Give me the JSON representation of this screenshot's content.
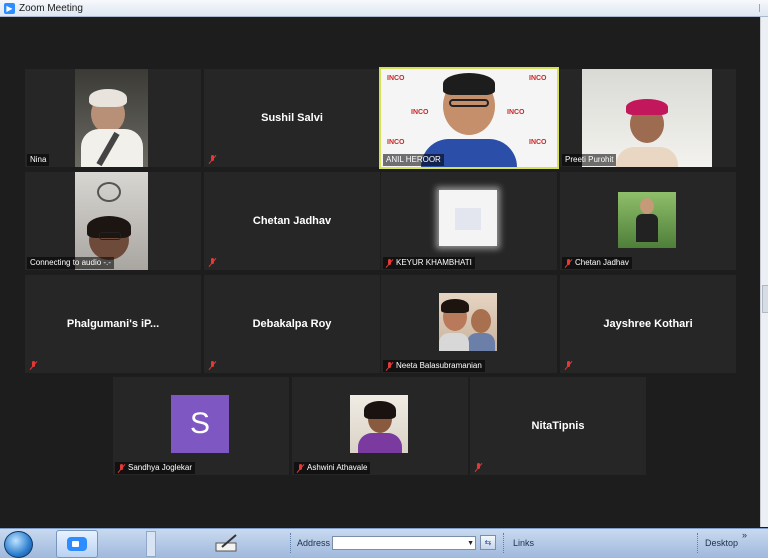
{
  "window": {
    "title": "Zoom Meeting",
    "app_icon": "zoom-camera-icon"
  },
  "participants": {
    "nina": "Nina",
    "sushil_salvi": "Sushil Salvi",
    "anil_heroor": "ANIL HEROOR",
    "preeti_purohit": "Preeti Purohit",
    "connecting": "Connecting to audio -.-",
    "chetan_jadhav_1": "Chetan Jadhav",
    "keyur_khambhati": "KEYUR KHAMBHATI",
    "chetan_jadhav_2": "Chetan Jadhav",
    "phalgumani": "Phalgumani's iP...",
    "debakalpa_roy": "Debakalpa Roy",
    "neeta_balasubramanian": "Neeta Balasubramanian",
    "jayshree_kothari": "Jayshree Kothari",
    "sandhya_joglekar": "Sandhya Joglekar",
    "sandhya_avatar_letter": "S",
    "ashwini_athavale": "Ashwini Athavale",
    "nitatipnis": "NitaTipnis"
  },
  "backdrop_logo_text": "INCO",
  "colors": {
    "active_speaker_border": "#d4e157",
    "muted_mic": "#e53935",
    "avatar_purple": "#7e57c2",
    "tile_bg": "#262626"
  },
  "taskbar": {
    "address_label": "Address",
    "links_label": "Links",
    "desktop_label": "Desktop",
    "address_value": ""
  }
}
